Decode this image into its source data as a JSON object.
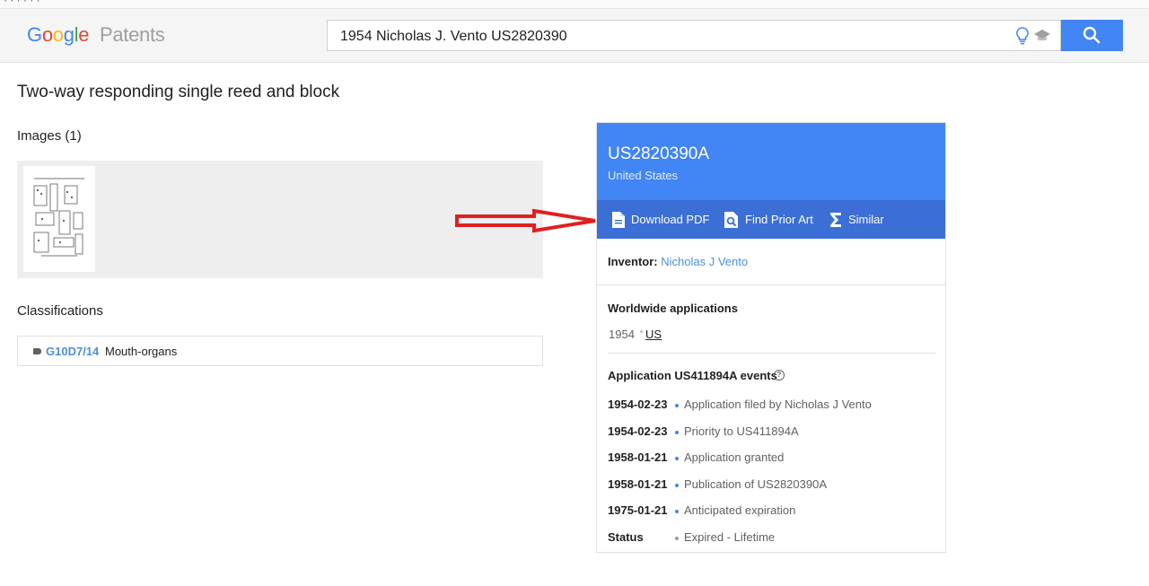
{
  "header": {
    "logo": {
      "google": "Google",
      "patents": "Patents",
      "colors": [
        "#4285f4",
        "#ea4335",
        "#fbbc05",
        "#4285f4",
        "#34a853",
        "#ea4335"
      ]
    },
    "search": {
      "value": "1954 Nicholas J. Vento US2820390"
    },
    "icons": [
      "lightbulb-icon",
      "graduation-cap-icon",
      "search-icon"
    ],
    "accent": "#4285f4"
  },
  "main": {
    "title": "Two-way responding single reed and block",
    "images_heading": "Images (1)",
    "classifications_heading": "Classifications",
    "classification": {
      "code": "G10D7/14",
      "description": "Mouth-organs"
    }
  },
  "card": {
    "publication_number": "US2820390A",
    "country": "United States",
    "actions": [
      {
        "label": "Download PDF",
        "icon": "document-icon"
      },
      {
        "label": "Find Prior Art",
        "icon": "search-document-icon"
      },
      {
        "label": "Similar",
        "icon": "sigma-icon"
      }
    ],
    "inventor_label": "Inventor:",
    "inventor_name": "Nicholas J Vento",
    "worldwide_heading": "Worldwide applications",
    "worldwide_year": "1954",
    "worldwide_country": "US",
    "events_heading": "Application US411894A events",
    "events": [
      {
        "date": "1954-02-23",
        "text": "Application filed by Nicholas J Vento"
      },
      {
        "date": "1954-02-23",
        "text": "Priority to US411894A"
      },
      {
        "date": "1958-01-21",
        "text": "Application granted"
      },
      {
        "date": "1958-01-21",
        "text": "Publication of US2820390A"
      },
      {
        "date": "1975-01-21",
        "text": "Anticipated expiration"
      },
      {
        "date": "Status",
        "text": "Expired - Lifetime"
      }
    ]
  },
  "annotation": {
    "arrow_color": "#e02020"
  }
}
